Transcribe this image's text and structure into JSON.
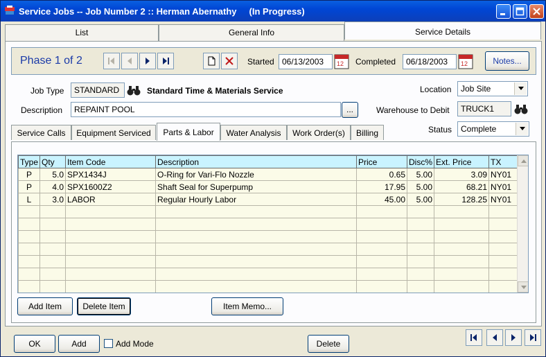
{
  "window": {
    "title": "Service Jobs -- Job Number 2 :: Herman Abernathy     (In Progress)"
  },
  "tabs": [
    {
      "label": "List"
    },
    {
      "label": "General Info"
    },
    {
      "label": "Service Details"
    }
  ],
  "phase": {
    "title": "Phase 1 of  2",
    "started_label": "Started",
    "started_value": "06/13/2003",
    "completed_label": "Completed",
    "completed_value": "06/18/2003",
    "notes_label": "Notes..."
  },
  "details": {
    "job_type_label": "Job Type",
    "job_type_value": "STANDARD",
    "job_type_desc": "Standard Time & Materials Service",
    "description_label": "Description",
    "description_value": "REPAINT POOL",
    "ellipsis_label": "...",
    "location_label": "Location",
    "location_value": "Job Site",
    "warehouse_label": "Warehouse to Debit",
    "warehouse_value": "TRUCK1",
    "status_label": "Status",
    "status_value": "Complete"
  },
  "subtabs": [
    {
      "label": "Service Calls"
    },
    {
      "label": "Equipment Serviced"
    },
    {
      "label": "Parts & Labor"
    },
    {
      "label": "Water Analysis"
    },
    {
      "label": "Work Order(s)"
    },
    {
      "label": "Billing"
    }
  ],
  "grid": {
    "columns": [
      "Type",
      "Qty",
      "Item Code",
      "Description",
      "Price",
      "Disc%",
      "Ext. Price",
      "TX"
    ],
    "rows": [
      {
        "type": "P",
        "qty": "5.0",
        "code": "SPX1434J",
        "desc": "O-Ring for Vari-Flo Nozzle",
        "price": "0.65",
        "disc": "5.00",
        "ext": "3.09",
        "tx": "NY01"
      },
      {
        "type": "P",
        "qty": "4.0",
        "code": "SPX1600Z2",
        "desc": "Shaft Seal for Superpump",
        "price": "17.95",
        "disc": "5.00",
        "ext": "68.21",
        "tx": "NY01"
      },
      {
        "type": "L",
        "qty": "3.0",
        "code": "LABOR",
        "desc": "Regular Hourly Labor",
        "price": "45.00",
        "disc": "5.00",
        "ext": "128.25",
        "tx": "NY01"
      }
    ]
  },
  "grid_buttons": {
    "add_item": "Add Item",
    "delete_item": "Delete Item",
    "item_memo": "Item Memo..."
  },
  "bottom": {
    "ok": "OK",
    "add": "Add",
    "add_mode": "Add Mode",
    "delete": "Delete"
  }
}
